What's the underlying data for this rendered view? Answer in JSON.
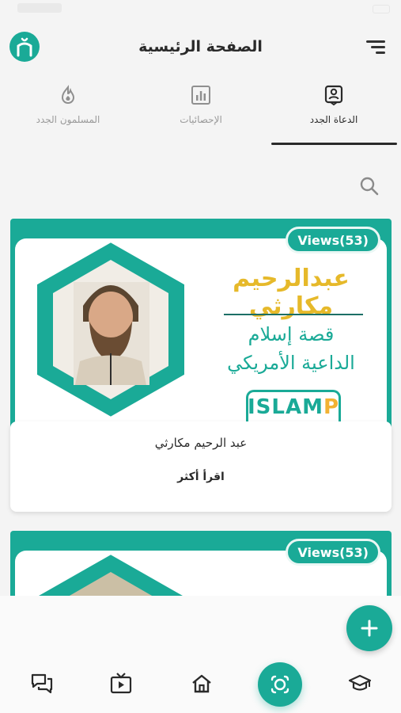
{
  "header": {
    "title": "الصفحة الرئيسية"
  },
  "tabs": [
    {
      "label": "المسلمون الجدد",
      "icon": "flame-icon",
      "active": false
    },
    {
      "label": "الإحصائيات",
      "icon": "stats-chart-icon",
      "active": false
    },
    {
      "label": "الدعاة الجدد",
      "icon": "preacher-badge-icon",
      "active": true
    }
  ],
  "cards": [
    {
      "views": "Views(53)",
      "banner_name": "عبدالرحيم مكارثي",
      "banner_sub1": "قصة إسلام",
      "banner_sub2": "الداعية الأمريكي",
      "logo_text": "ISLAMP",
      "person_name": "عبد الرحيم مكارثي",
      "more_label": "اقرأ أكثر"
    },
    {
      "views": "Views(53)"
    }
  ],
  "colors": {
    "accent": "#1aaa97",
    "gold": "#e6b92a"
  },
  "bottom_nav": [
    {
      "icon": "chat-icon"
    },
    {
      "icon": "tv-icon"
    },
    {
      "icon": "home-icon"
    },
    {
      "icon": "scan-icon",
      "active": true
    },
    {
      "icon": "graduation-cap-icon"
    }
  ]
}
